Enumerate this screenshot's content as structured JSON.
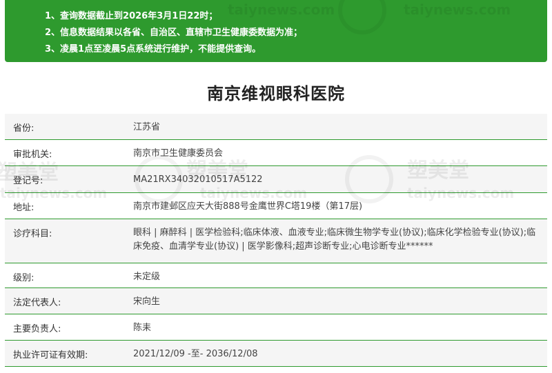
{
  "notice": {
    "lines": [
      "1、查询数据截止到2026年3月1日22时；",
      "2、信息数据结果以各省、自治区、直辖市卫生健康委数据为准；",
      "3、凌晨1点至凌晨5点系统进行维护，不能提供查询。"
    ],
    "bg_color": "#2e9a2e"
  },
  "watermark": {
    "brand": "塑美堂",
    "site": "taiynews.com"
  },
  "hospital": {
    "name": "南京维视眼科医院",
    "fields": [
      {
        "label": "省份:",
        "value": "江苏省"
      },
      {
        "label": "审批机关:",
        "value": "南京市卫生健康委员会"
      },
      {
        "label": "登记号:",
        "value": "MA21RX34032010517A5122"
      },
      {
        "label": "地址:",
        "value": "南京市建邺区应天大街888号金鹰世界C塔19楼（第17层)"
      },
      {
        "label": "诊疗科目:",
        "value": "眼科 | 麻醉科 | 医学检验科;临床体液、血液专业;临床微生物学专业(协议);临床化学检验专业(协议);临床免疫、血清学专业(协议) | 医学影像科;超声诊断专业;心电诊断专业******"
      },
      {
        "label": "级别:",
        "value": "未定级"
      },
      {
        "label": "法定代表人:",
        "value": "宋向生"
      },
      {
        "label": "主要负责人:",
        "value": "陈耒"
      },
      {
        "label": "执业许可证有效期:",
        "value": "2021/12/09 -至- 2036/12/08"
      }
    ]
  }
}
